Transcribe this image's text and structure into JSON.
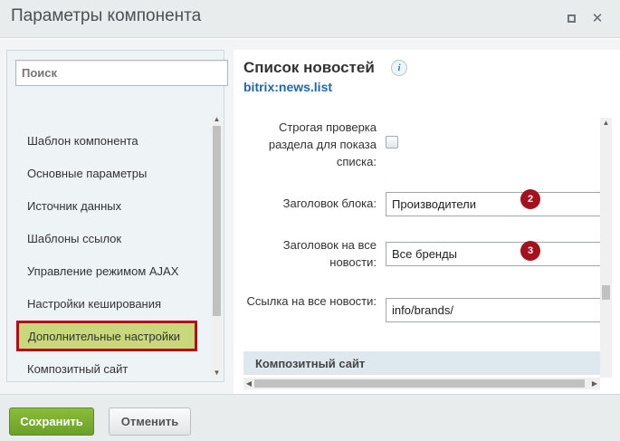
{
  "window": {
    "title": "Параметры компонента"
  },
  "sidebar": {
    "search_placeholder": "Поиск",
    "items": [
      {
        "label": "Шаблон компонента"
      },
      {
        "label": "Основные параметры"
      },
      {
        "label": "Источник данных"
      },
      {
        "label": "Шаблоны ссылок"
      },
      {
        "label": "Управление режимом AJAX"
      },
      {
        "label": "Настройки кеширования"
      },
      {
        "label": "Дополнительные настройки",
        "selected": true
      },
      {
        "label": "Композитный сайт"
      }
    ]
  },
  "component": {
    "title": "Список новостей",
    "info_icon": "info-icon",
    "code": "bitrix:news.list"
  },
  "params": [
    {
      "label": "Строгая проверка раздела для показа списка:",
      "type": "checkbox",
      "checked": false
    },
    {
      "label": "Заголовок блока:",
      "value": "Производители",
      "badge": "2"
    },
    {
      "label": "Заголовок на все новости:",
      "value": "Все бренды",
      "badge": "3"
    },
    {
      "label": "Ссылка на все новости:",
      "value": "info/brands/"
    }
  ],
  "section": {
    "title": "Композитный сайт"
  },
  "footer": {
    "save_label": "Сохранить",
    "cancel_label": "Отменить"
  },
  "colors": {
    "accent_green": "#7bb034",
    "selection_border": "#b70b17",
    "selected_item_bg": "#c9d87b",
    "badge": "#a3121d",
    "link_blue": "#2067b0"
  }
}
